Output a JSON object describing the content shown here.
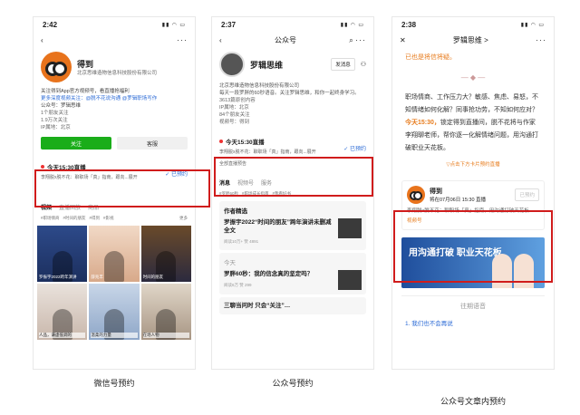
{
  "phone1": {
    "time": "2:42",
    "name": "得到",
    "company": "北京思维造物信息科技股份有限公司",
    "desc": [
      "关注得到App官方视频号，看直播抢福利",
      "更多深度视频关注：@脱不花说沟通 @罗辑职场写作",
      "公众号：罗辑思维"
    ],
    "stats": [
      "1个朋友关注",
      "1.9万次关注"
    ],
    "location": "IP属地：北京",
    "follow_label": "关注",
    "service_label": "客服",
    "live_title": "今天15:30直播",
    "live_desc": "李翔脱x脱不花：聊职场「真」指南，跟向...展开",
    "reserve_label": "已预约",
    "tabs": [
      "视频",
      "直播回放",
      "商品"
    ],
    "tags": [
      "#职场情商",
      "#时间的朋友",
      "#得到",
      "#影视"
    ],
    "more_label": "更多",
    "grid": [
      "罗振宇2022跨年演讲",
      "薛兆丰",
      "时间的朋友",
      "人品，谦虚低调的",
      "温柔的力量",
      "在场人物"
    ],
    "caption": "微信号预约"
  },
  "phone2": {
    "time": "2:37",
    "title": "公众号",
    "name": "罗辑思维",
    "msg_label": "发消息",
    "company": "北京思维造物信息科技股份有限公司",
    "desc": "每天一段罗胖的60秒语音。关注罗辑思维，和你一起终身学习。",
    "stats": [
      "3613篇原创内容",
      "IP属地：北京",
      "84个朋友关注"
    ],
    "video": "视频号：得到",
    "live_title": "今天15:30直播",
    "live_desc": "李翔脱x脱不花：聊职场「真」指南，跟向...展开",
    "reserve_label": "已预约",
    "all_label": "全部直播预告",
    "tabs": [
      "消息",
      "视频号",
      "服务"
    ],
    "tags": [
      "#罗胖60秒",
      "#职场成长指南",
      "#我看好书"
    ],
    "sec1_head": "作者精选",
    "sec1_title": "罗振宇2022“时间的朋友”跨年演讲未删减全文",
    "sec1_meta": "阅读10万+ 赞 4891",
    "sec2_head": "今天",
    "sec2_title": "罗胖60秒：我的信念真的坚定吗？",
    "sec2_meta": "阅读6万 赞 299",
    "sec3_title": "三聊当问时 只会“关注”…",
    "caption": "公众号预约"
  },
  "phone3": {
    "time": "2:38",
    "title": "罗辑思维 >",
    "top_text": "已也是将信将疑。",
    "body": "职场情商、工作压力大？敏感、焦虑、易怒，不知情绪如何化解？同事抢功劳，不知如何应对？",
    "highlight": "今天15:30，",
    "body2": "锁定得到直播间，脱不花将与作家李翔聊老师，帮你逐一化解情绪问题，用沟通打破职业天花板。",
    "link": "▽点击下方卡片预约直播",
    "card_name": "得到",
    "card_time": "将在07月06日 15:30 直播",
    "card_btn": "已预约",
    "card_desc": "李翔脱x脱不花：聊职场「真」指南，用沟通打破天花板",
    "card_foot": "视频号",
    "banner": "用沟通打破 职业天花板",
    "prev": "往期语音",
    "prev_item": "我们也不会再说",
    "caption": "公众号文章内预约"
  }
}
